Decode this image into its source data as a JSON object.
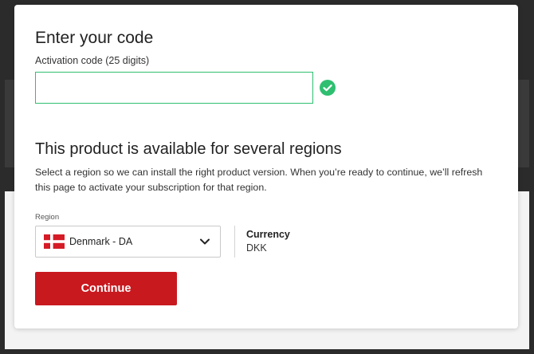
{
  "header": {
    "title": "Enter your code",
    "code_label": "Activation code (25 digits)"
  },
  "code_input": {
    "value": "",
    "placeholder": ""
  },
  "regions": {
    "title": "This product is available for several regions",
    "description": "Select a region so we can install the right product version. When you’re ready to continue, we’ll refresh this page to activate your subscription for that region.",
    "label": "Region",
    "selected": "Denmark - DA"
  },
  "currency": {
    "title": "Currency",
    "value": "DKK"
  },
  "actions": {
    "continue_label": "Continue"
  },
  "colors": {
    "accent_red": "#c8191f",
    "valid_green": "#2fbf71",
    "flag_red": "#d51b26"
  },
  "icons": {
    "valid": "check-circle-icon",
    "dropdown": "chevron-down-icon",
    "flag": "denmark-flag-icon"
  }
}
